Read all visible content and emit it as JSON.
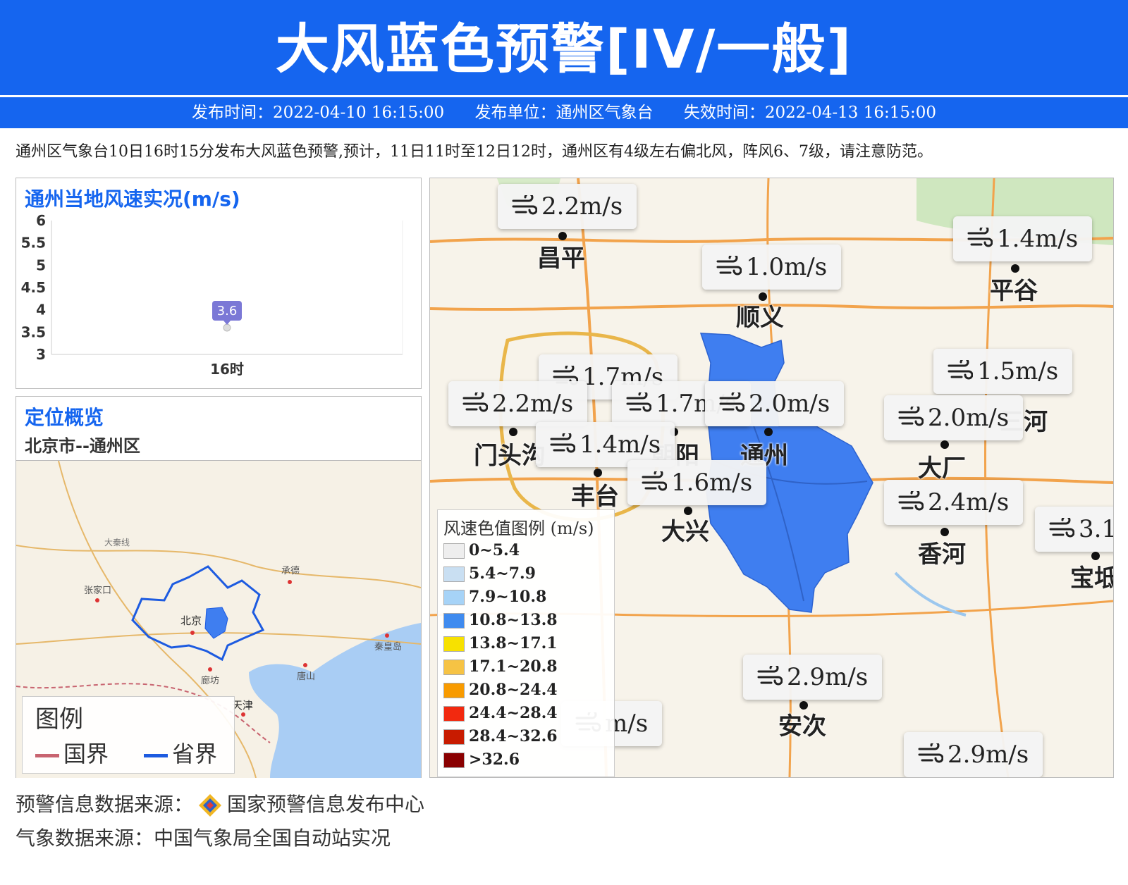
{
  "header": {
    "title": "大风蓝色预警[IV/一般]"
  },
  "meta": {
    "issue_time": "发布时间：2022-04-10 16:15:00",
    "issuer": "发布单位：通州区气象台",
    "expire_time": "失效时间：2022-04-13 16:15:00"
  },
  "description": "通州区气象台10日16时15分发布大风蓝色预警,预计，11日11时至12日12时，通州区有4级左右偏北风，阵风6、7级，请注意防范。",
  "chart_panel": {
    "title": "通州当地风速实况(m/s)"
  },
  "chart_data": {
    "type": "scatter",
    "title": "通州当地风速实况(m/s)",
    "categories": [
      "16时"
    ],
    "x": [
      "16时"
    ],
    "values": [
      3.6
    ],
    "data_labels": [
      "3.6"
    ],
    "yticks": [
      "3",
      "3.5",
      "4",
      "4.5",
      "5",
      "5.5",
      "6"
    ],
    "ylim": [
      3,
      6
    ],
    "point_color": "#7b78d6",
    "xlabel": "",
    "ylabel": ""
  },
  "location_panel": {
    "title": "定位概览",
    "subtitle": "北京市--通州区",
    "place_names": [
      "承德",
      "张家口",
      "北京",
      "廊坊",
      "唐山",
      "秦皇岛",
      "天津",
      "大秦线"
    ],
    "legend": {
      "title": "图例",
      "national": "国界",
      "provincial": "省界",
      "national_color": "#c86470",
      "provincial_color": "#1d5be0"
    }
  },
  "map": {
    "region_color": "#3f7ef0",
    "wind_labels": [
      {
        "value": "2.2m/s"
      },
      {
        "value": "1.4m/s"
      },
      {
        "value": "1.0m/s"
      },
      {
        "value": "1.7m/s"
      },
      {
        "value": "1.5m/s"
      },
      {
        "value": "2.2m/s"
      },
      {
        "value": "1.7m/s"
      },
      {
        "value": "2.0m/s"
      },
      {
        "value": "2.0m/s"
      },
      {
        "value": "1.4m/s"
      },
      {
        "value": "1.6m/s"
      },
      {
        "value": "2.4m/s"
      },
      {
        "value": "3.1"
      },
      {
        "value": "2.9m/s"
      },
      {
        "value": "m/s"
      },
      {
        "value": "2.9m/s"
      }
    ],
    "cities": [
      "昌平",
      "平谷",
      "顺义",
      "门头沟",
      "朝阳",
      "通州",
      "大厂",
      "丰台",
      "大兴",
      "香河",
      "安次",
      "宝坻",
      "三河"
    ],
    "scale_legend": {
      "title": "风速色值图例 (m/s)",
      "items": [
        {
          "label": "0~5.4",
          "color": "#eeeeee"
        },
        {
          "label": "5.4~7.9",
          "color": "#c9dff2"
        },
        {
          "label": "7.9~10.8",
          "color": "#a6d3f7"
        },
        {
          "label": "10.8~13.8",
          "color": "#3f8bef"
        },
        {
          "label": "13.8~17.1",
          "color": "#f7e100"
        },
        {
          "label": "17.1~20.8",
          "color": "#f6c344"
        },
        {
          "label": "20.8~24.4",
          "color": "#f89b00"
        },
        {
          "label": "24.4~28.4",
          "color": "#f2290f"
        },
        {
          "label": "28.4~32.6",
          "color": "#c81b00"
        },
        {
          "label": ">32.6",
          "color": "#8a0000"
        }
      ]
    }
  },
  "footer": {
    "source_warning_prefix": "预警信息数据来源：",
    "source_warning_name": "国家预警信息发布中心",
    "source_weather": "气象数据来源：中国气象局全国自动站实况"
  },
  "colors": {
    "brand_blue": "#1565ef"
  }
}
